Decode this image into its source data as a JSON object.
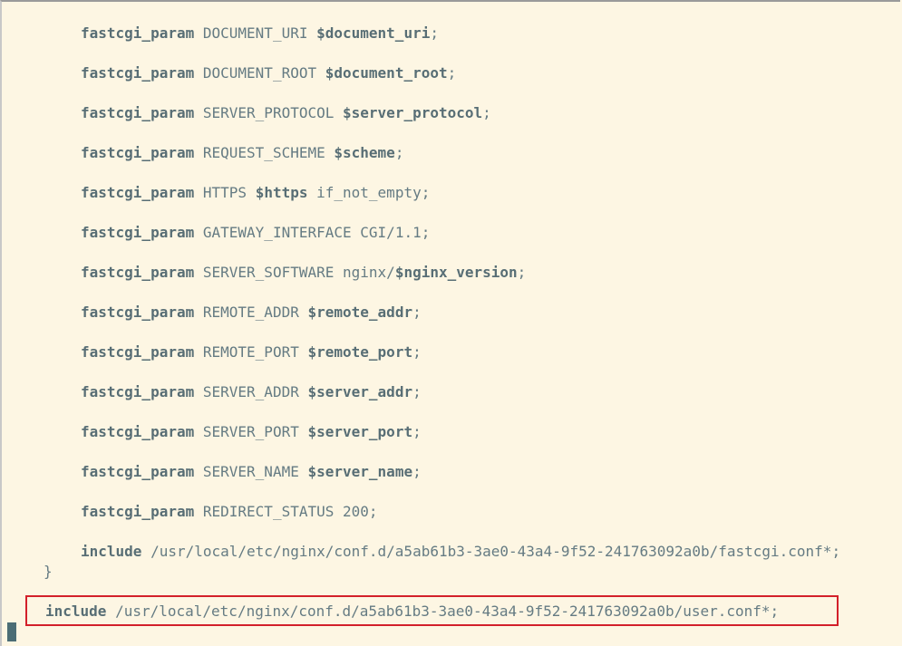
{
  "editor": {
    "lines": [
      {
        "kw": "fastcgi_param",
        "name": "DOCUMENT_URI",
        "var": "$document_uri",
        "tail": ";"
      },
      {
        "kw": "fastcgi_param",
        "name": "DOCUMENT_ROOT",
        "var": "$document_root",
        "tail": ";"
      },
      {
        "kw": "fastcgi_param",
        "name": "SERVER_PROTOCOL",
        "var": "$server_protocol",
        "tail": ";"
      },
      {
        "kw": "fastcgi_param",
        "name": "REQUEST_SCHEME",
        "var": "$scheme",
        "tail": ";"
      },
      {
        "kw": "fastcgi_param",
        "name": "HTTPS",
        "var": "$https",
        "tail": " if_not_empty;"
      },
      {
        "kw": "fastcgi_param",
        "name": "GATEWAY_INTERFACE",
        "var": "",
        "tail": "CGI/1.1;"
      },
      {
        "kw": "fastcgi_param",
        "name": "SERVER_SOFTWARE",
        "pre": "nginx/",
        "var": "$nginx_version",
        "tail": ";"
      },
      {
        "kw": "fastcgi_param",
        "name": "REMOTE_ADDR",
        "var": "$remote_addr",
        "tail": ";"
      },
      {
        "kw": "fastcgi_param",
        "name": "REMOTE_PORT",
        "var": "$remote_port",
        "tail": ";"
      },
      {
        "kw": "fastcgi_param",
        "name": "SERVER_ADDR",
        "var": "$server_addr",
        "tail": ";"
      },
      {
        "kw": "fastcgi_param",
        "name": "SERVER_PORT",
        "var": "$server_port",
        "tail": ";"
      },
      {
        "kw": "fastcgi_param",
        "name": "SERVER_NAME",
        "var": "$server_name",
        "tail": ";"
      },
      {
        "kw": "fastcgi_param",
        "name": "REDIRECT_STATUS",
        "var": "",
        "tail": "200;"
      }
    ],
    "include_fastcgi": {
      "kw": "include",
      "path": "/usr/local/etc/nginx/conf.d/a5ab61b3-3ae0-43a4-9f52-241763092a0b/fastcgi.conf*;"
    },
    "close_brace": "}",
    "include_user": {
      "kw": "include",
      "path": "/usr/local/etc/nginx/conf.d/a5ab61b3-3ae0-43a4-9f52-241763092a0b/user.conf*;"
    },
    "colors": {
      "background": "#fdf6e3",
      "text": "#657b83",
      "keyword": "#586e75",
      "highlight_border": "#d3202a",
      "cursor": "#4b6d75"
    }
  }
}
